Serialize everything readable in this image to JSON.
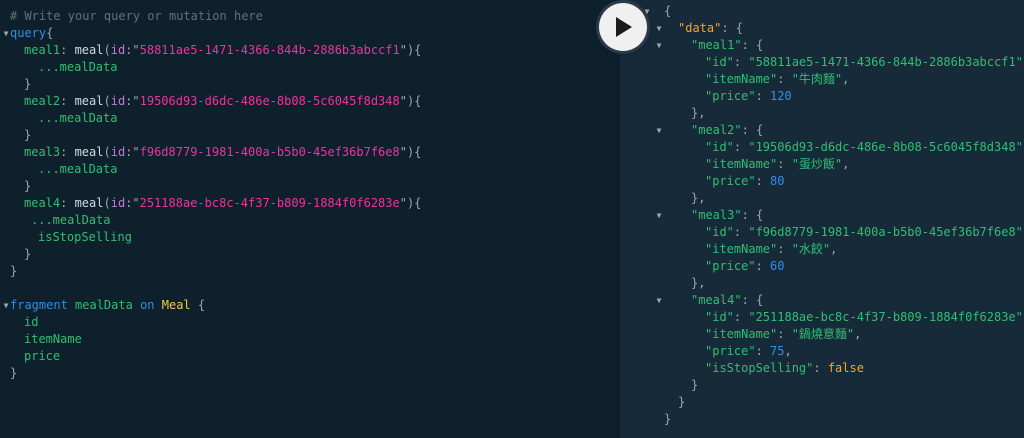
{
  "query": {
    "comment": "# Write your query or mutation here",
    "op_keyword": "query",
    "meals": [
      {
        "alias": "meal1",
        "field": "meal",
        "arg": "id",
        "id": "58811ae5-1471-4366-844b-2886b3abccf1"
      },
      {
        "alias": "meal2",
        "field": "meal",
        "arg": "id",
        "id": "19506d93-d6dc-486e-8b08-5c6045f8d348"
      },
      {
        "alias": "meal3",
        "field": "meal",
        "arg": "id",
        "id": "f96d8779-1981-400a-b5b0-45ef36b7f6e8"
      },
      {
        "alias": "meal4",
        "field": "meal",
        "arg": "id",
        "id": "251188ae-bc8c-4f37-b809-1884f0f6283e"
      }
    ],
    "spread": "...mealData",
    "extra_field": "isStopSelling",
    "fragment": {
      "keyword": "fragment",
      "name": "mealData",
      "on": "on",
      "type": "Meal",
      "fields": [
        "id",
        "itemName",
        "price"
      ]
    }
  },
  "result": {
    "data_key": "\"data\"",
    "meals": [
      {
        "key": "\"meal1\"",
        "id": "\"58811ae5-1471-4366-844b-2886b3abccf1\"",
        "itemName": "\"牛肉麵\"",
        "price": "120"
      },
      {
        "key": "\"meal2\"",
        "id": "\"19506d93-d6dc-486e-8b08-5c6045f8d348\"",
        "itemName": "\"蛋炒飯\"",
        "price": "80"
      },
      {
        "key": "\"meal3\"",
        "id": "\"f96d8779-1981-400a-b5b0-45ef36b7f6e8\"",
        "itemName": "\"水餃\"",
        "price": "60"
      },
      {
        "key": "\"meal4\"",
        "id": "\"251188ae-bc8c-4f37-b809-1884f0f6283e\"",
        "itemName": "\"鍋燒意麵\"",
        "price": "75",
        "isStopSelling": "false"
      }
    ],
    "keys": {
      "id": "\"id\"",
      "itemName": "\"itemName\"",
      "price": "\"price\"",
      "isStopSelling": "\"isStopSelling\""
    }
  },
  "icons": {
    "run": "play-icon",
    "fold": "caret-down-icon"
  }
}
